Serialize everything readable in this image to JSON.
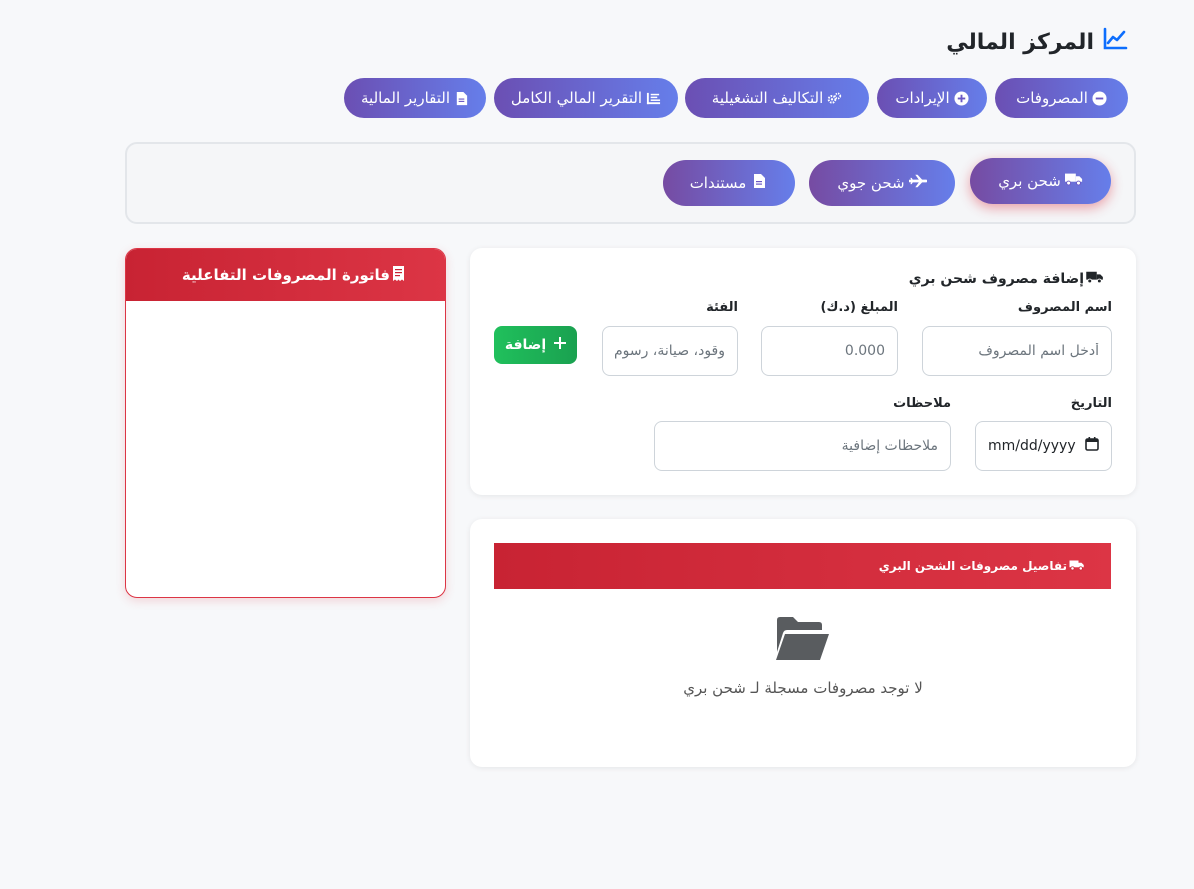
{
  "header": {
    "title": "المركز المالي",
    "icon": "chart-line-icon",
    "accent": "#0d6efd"
  },
  "nav": {
    "items": [
      {
        "label": "المصروفات",
        "icon": "minus-circle-icon"
      },
      {
        "label": "الإيرادات",
        "icon": "plus-circle-icon"
      },
      {
        "label": "التكاليف التشغيلية",
        "icon": "gears-icon"
      },
      {
        "label": "التقرير المالي الكامل",
        "icon": "list-report-icon"
      },
      {
        "label": "التقارير المالية",
        "icon": "file-icon"
      }
    ]
  },
  "subtabs": {
    "items": [
      {
        "label": "شحن بري",
        "icon": "truck-icon",
        "active": true
      },
      {
        "label": "شحن جوي",
        "icon": "plane-icon",
        "active": false
      },
      {
        "label": "مستندات",
        "icon": "file-icon",
        "active": false
      }
    ]
  },
  "invoice": {
    "title": "فاتورة المصروفات التفاعلية",
    "icon": "receipt-icon"
  },
  "form": {
    "title": "إضافة مصروف شحن بري",
    "name_label": "اسم المصروف",
    "name_placeholder": "أدخل اسم المصروف",
    "amount_label": "المبلغ (د.ك)",
    "amount_placeholder": "0.000",
    "category_label": "الفئة",
    "category_placeholder": "وقود، صيانة، رسوم",
    "add_button": "إضافة",
    "date_label": "التاريخ",
    "date_value": "mm/dd/yyyy",
    "notes_label": "ملاحظات",
    "notes_placeholder": "ملاحظات إضافية"
  },
  "details": {
    "title": "تفاصيل مصروفات الشحن البري",
    "empty_text": "لا توجد مصروفات مسجلة لـ شحن بري"
  },
  "colors": {
    "purple_gradient": [
      "#764ba2",
      "#667eea"
    ],
    "red_gradient": [
      "#c82333",
      "#dc3545"
    ],
    "green": "#20c05c"
  }
}
